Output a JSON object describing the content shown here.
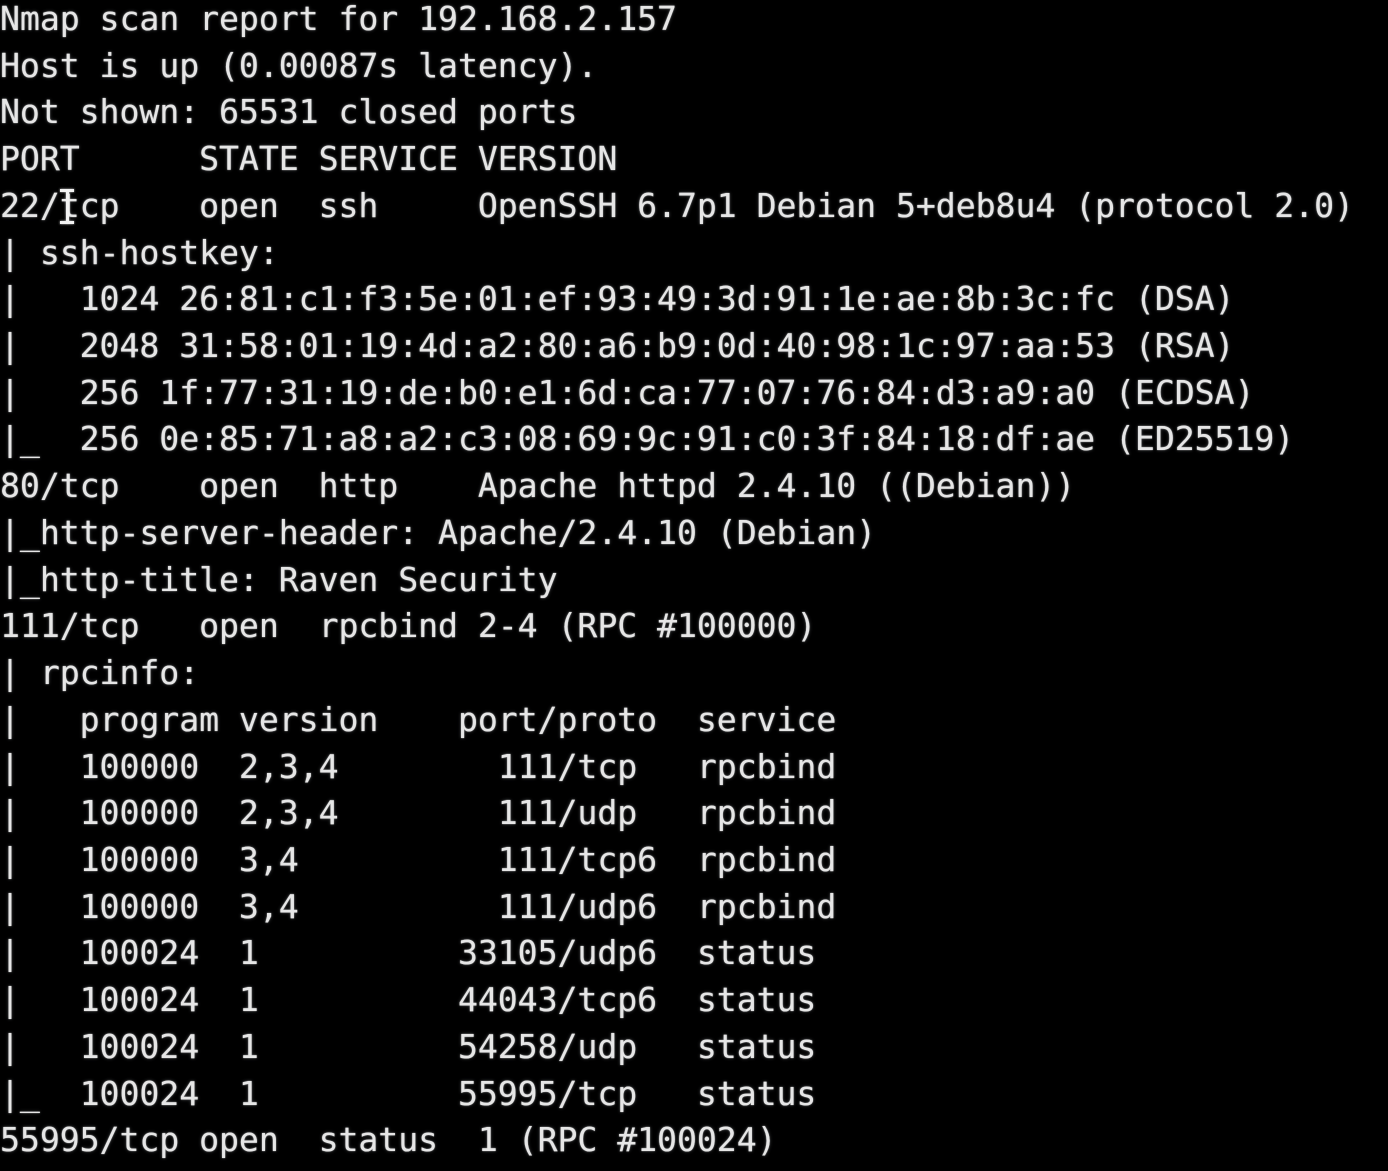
{
  "terminal": {
    "background_color": "#000000",
    "foreground_color": "#e6e6e6",
    "cursor_icon": "text-ibeam-cursor",
    "scan": {
      "report_header": "Nmap scan report for 192.168.2.157",
      "target_host": "192.168.2.157",
      "host_status": "Host is up (0.00087s latency).",
      "latency": "0.00087s",
      "not_shown": "Not shown: 65531 closed ports",
      "closed_ports_count": "65531"
    },
    "port_table": {
      "header": "PORT         STATE SERVICE VERSION",
      "columns": [
        "PORT",
        "STATE",
        "SERVICE",
        "VERSION"
      ]
    },
    "lines": [
      "Nmap scan report for 192.168.2.157",
      "Host is up (0.00087s latency).",
      "Not shown: 65531 closed ports",
      "PORT      STATE SERVICE VERSION",
      "22/tcp    open  ssh     OpenSSH 6.7p1 Debian 5+deb8u4 (protocol 2.0)",
      "| ssh-hostkey:",
      "|   1024 26:81:c1:f3:5e:01:ef:93:49:3d:91:1e:ae:8b:3c:fc (DSA)",
      "|   2048 31:58:01:19:4d:a2:80:a6:b9:0d:40:98:1c:97:aa:53 (RSA)",
      "|   256 1f:77:31:19:de:b0:e1:6d:ca:77:07:76:84:d3:a9:a0 (ECDSA)",
      "|_  256 0e:85:71:a8:a2:c3:08:69:9c:91:c0:3f:84:18:df:ae (ED25519)",
      "80/tcp    open  http    Apache httpd 2.4.10 ((Debian))",
      "|_http-server-header: Apache/2.4.10 (Debian)",
      "|_http-title: Raven Security",
      "111/tcp   open  rpcbind 2-4 (RPC #100000)",
      "| rpcinfo:",
      "|   program version    port/proto  service",
      "|   100000  2,3,4        111/tcp   rpcbind",
      "|   100000  2,3,4        111/udp   rpcbind",
      "|   100000  3,4          111/tcp6  rpcbind",
      "|   100000  3,4          111/udp6  rpcbind",
      "|   100024  1          33105/udp6  status",
      "|   100024  1          44043/tcp6  status",
      "|   100024  1          54258/udp   status",
      "|_  100024  1          55995/tcp   status",
      "55995/tcp open  status  1 (RPC #100024)"
    ],
    "ports": [
      {
        "port": "22/tcp",
        "state": "open",
        "service": "ssh",
        "version": "OpenSSH 6.7p1 Debian 5+deb8u4 (protocol 2.0)"
      },
      {
        "port": "80/tcp",
        "state": "open",
        "service": "http",
        "version": "Apache httpd 2.4.10 ((Debian))"
      },
      {
        "port": "111/tcp",
        "state": "open",
        "service": "rpcbind",
        "version": "2-4 (RPC #100000)"
      },
      {
        "port": "55995/tcp",
        "state": "open",
        "service": "status",
        "version": "1 (RPC #100024)"
      }
    ],
    "ssh_hostkey": {
      "script_label": "ssh-hostkey:",
      "keys": [
        {
          "bits": "1024",
          "fingerprint": "26:81:c1:f3:5e:01:ef:93:49:3d:91:1e:ae:8b:3c:fc",
          "type": "(DSA)"
        },
        {
          "bits": "2048",
          "fingerprint": "31:58:01:19:4d:a2:80:a6:b9:0d:40:98:1c:97:aa:53",
          "type": "(RSA)"
        },
        {
          "bits": "256",
          "fingerprint": "1f:77:31:19:de:b0:e1:6d:ca:77:07:76:84:d3:a9:a0",
          "type": "(ECDSA)"
        },
        {
          "bits": "256",
          "fingerprint": "0e:85:71:a8:a2:c3:08:69:9c:91:c0:3f:84:18:df:ae",
          "type": "(ED25519)"
        }
      ]
    },
    "http_scripts": {
      "server_header_label": "http-server-header:",
      "server_header_value": "Apache/2.4.10 (Debian)",
      "title_label": "http-title:",
      "title_value": "Raven Security"
    },
    "rpcinfo": {
      "script_label": "rpcinfo:",
      "columns": [
        "program",
        "version",
        "port/proto",
        "service"
      ],
      "rows": [
        {
          "program": "100000",
          "version": "2,3,4",
          "port_proto": "111/tcp",
          "service": "rpcbind"
        },
        {
          "program": "100000",
          "version": "2,3,4",
          "port_proto": "111/udp",
          "service": "rpcbind"
        },
        {
          "program": "100000",
          "version": "3,4",
          "port_proto": "111/tcp6",
          "service": "rpcbind"
        },
        {
          "program": "100000",
          "version": "3,4",
          "port_proto": "111/udp6",
          "service": "rpcbind"
        },
        {
          "program": "100024",
          "version": "1",
          "port_proto": "33105/udp6",
          "service": "status"
        },
        {
          "program": "100024",
          "version": "1",
          "port_proto": "44043/tcp6",
          "service": "status"
        },
        {
          "program": "100024",
          "version": "1",
          "port_proto": "54258/udp",
          "service": "status"
        },
        {
          "program": "100024",
          "version": "1",
          "port_proto": "55995/tcp",
          "service": "status"
        }
      ]
    }
  }
}
